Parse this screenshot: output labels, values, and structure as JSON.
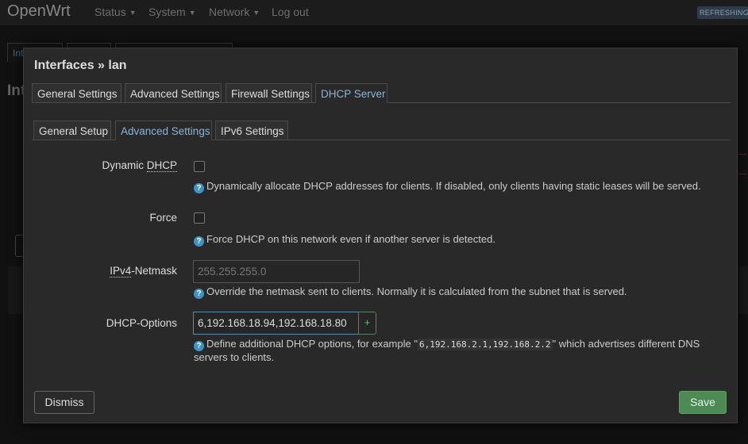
{
  "header": {
    "brand": "OpenWrt",
    "nav": [
      {
        "label": "Status"
      },
      {
        "label": "System"
      },
      {
        "label": "Network"
      },
      {
        "label": "Log out"
      }
    ],
    "refreshing_badge": "REFRESHING"
  },
  "background": {
    "tabs": [
      {
        "label": "Int"
      }
    ],
    "heading": "Int"
  },
  "modal": {
    "title": "Interfaces » lan",
    "main_tabs": [
      {
        "label": "General Settings"
      },
      {
        "label": "Advanced Settings"
      },
      {
        "label": "Firewall Settings"
      },
      {
        "label": "DHCP Server",
        "active": true
      }
    ],
    "sub_tabs": [
      {
        "label": "General Setup"
      },
      {
        "label": "Advanced Settings",
        "active": true
      },
      {
        "label": "IPv6 Settings"
      }
    ],
    "fields": {
      "dynamic_dhcp": {
        "label_prefix": "Dynamic ",
        "label_abbr": "DHCP",
        "checked": false,
        "hint": "Dynamically allocate DHCP addresses for clients. If disabled, only clients having static leases will be served."
      },
      "force": {
        "label": "Force",
        "checked": false,
        "hint": "Force DHCP on this network even if another server is detected."
      },
      "ipv4_netmask": {
        "label_abbr": "IPv4",
        "label_suffix": "-Netmask",
        "value": "",
        "placeholder": "255.255.255.0",
        "hint": "Override the netmask sent to clients. Normally it is calculated from the subnet that is served."
      },
      "dhcp_options": {
        "label": "DHCP-Options",
        "value": "6,192.168.18.94,192.168.18.80",
        "add_label": "+",
        "hint_prefix": "Define additional DHCP options, for example \"",
        "hint_code": "6,192.168.2.1,192.168.2.2",
        "hint_suffix": "\" which advertises different DNS servers to clients."
      }
    },
    "buttons": {
      "dismiss": "Dismiss",
      "save": "Save"
    }
  },
  "colors": {
    "accent": "#8ab4d4",
    "save": "#4d8a56",
    "info_icon": "#3f92c4"
  }
}
